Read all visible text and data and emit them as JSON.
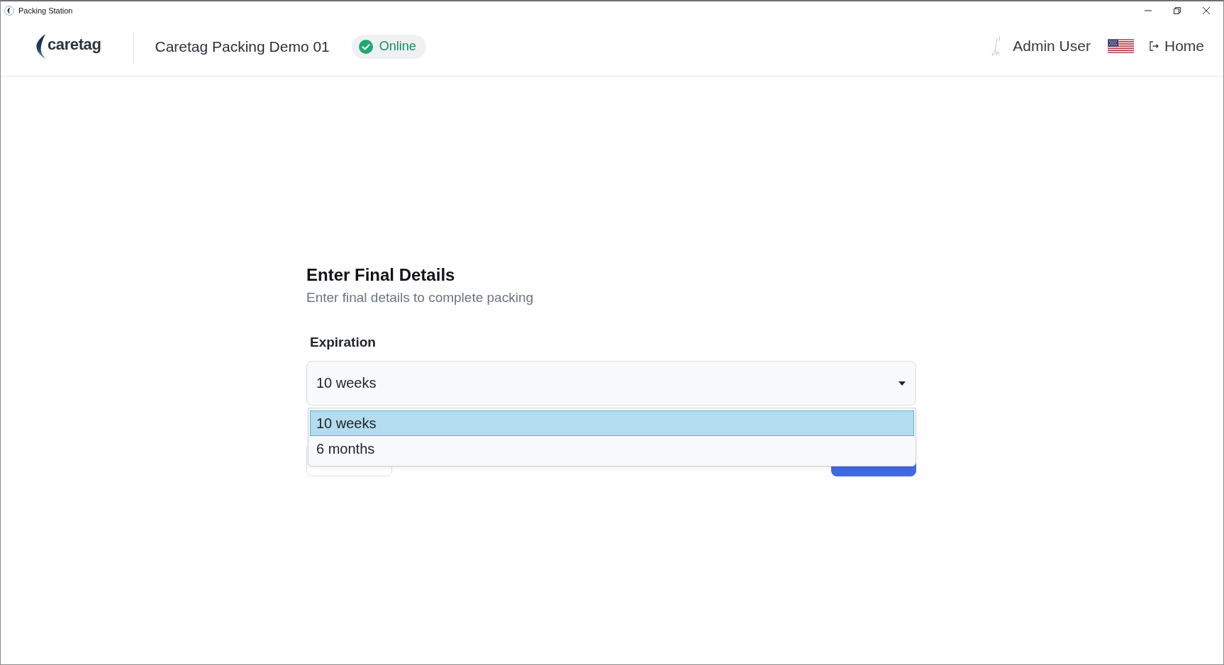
{
  "window": {
    "title": "Packing Station"
  },
  "header": {
    "logo_text": "caretag",
    "station_name": "Caretag Packing Demo 01",
    "status": {
      "label": "Online",
      "online": true
    },
    "user_name": "Admin User",
    "home_link": "Home"
  },
  "form": {
    "title": "Enter Final Details",
    "subtitle": "Enter final details to complete packing",
    "fields": [
      {
        "label": "Expiration",
        "value": "10 weeks",
        "expanded": true,
        "options": [
          {
            "label": "10 weeks",
            "selected": true
          },
          {
            "label": "6 months",
            "selected": false
          }
        ]
      }
    ],
    "buttons": [
      {
        "kind": "secondary"
      },
      {
        "kind": "primary"
      }
    ]
  }
}
